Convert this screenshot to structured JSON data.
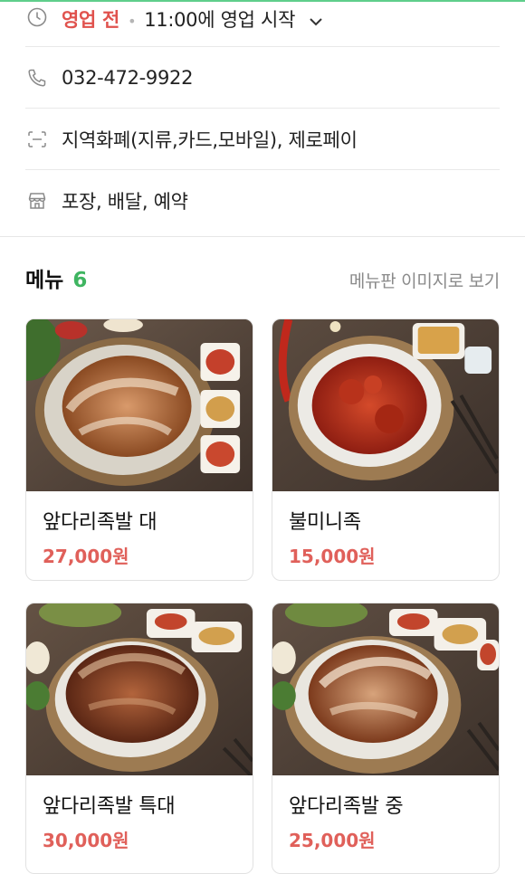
{
  "hours": {
    "status": "영업 전",
    "open_text": "11:00에 영업 시작"
  },
  "phone": "032-472-9922",
  "payment": "지역화폐(지류,카드,모바일), 제로페이",
  "services": "포장, 배달, 예약",
  "menu": {
    "title": "메뉴",
    "count": "6",
    "board_link": "메뉴판 이미지로 보기",
    "items": [
      {
        "name": "앞다리족발 대",
        "price": "27,000원",
        "image_icon": "sliced-jokbal-platter"
      },
      {
        "name": "불미니족",
        "price": "15,000원",
        "image_icon": "spicy-mini-jokbal-plate"
      },
      {
        "name": "앞다리족발 특대",
        "price": "30,000원",
        "image_icon": "large-jokbal-platter"
      },
      {
        "name": "앞다리족발 중",
        "price": "25,000원",
        "image_icon": "medium-jokbal-platter"
      }
    ]
  },
  "colors": {
    "accent_green": "#3fb561",
    "closed_red": "#e0524d",
    "price_red": "#e0605a"
  }
}
